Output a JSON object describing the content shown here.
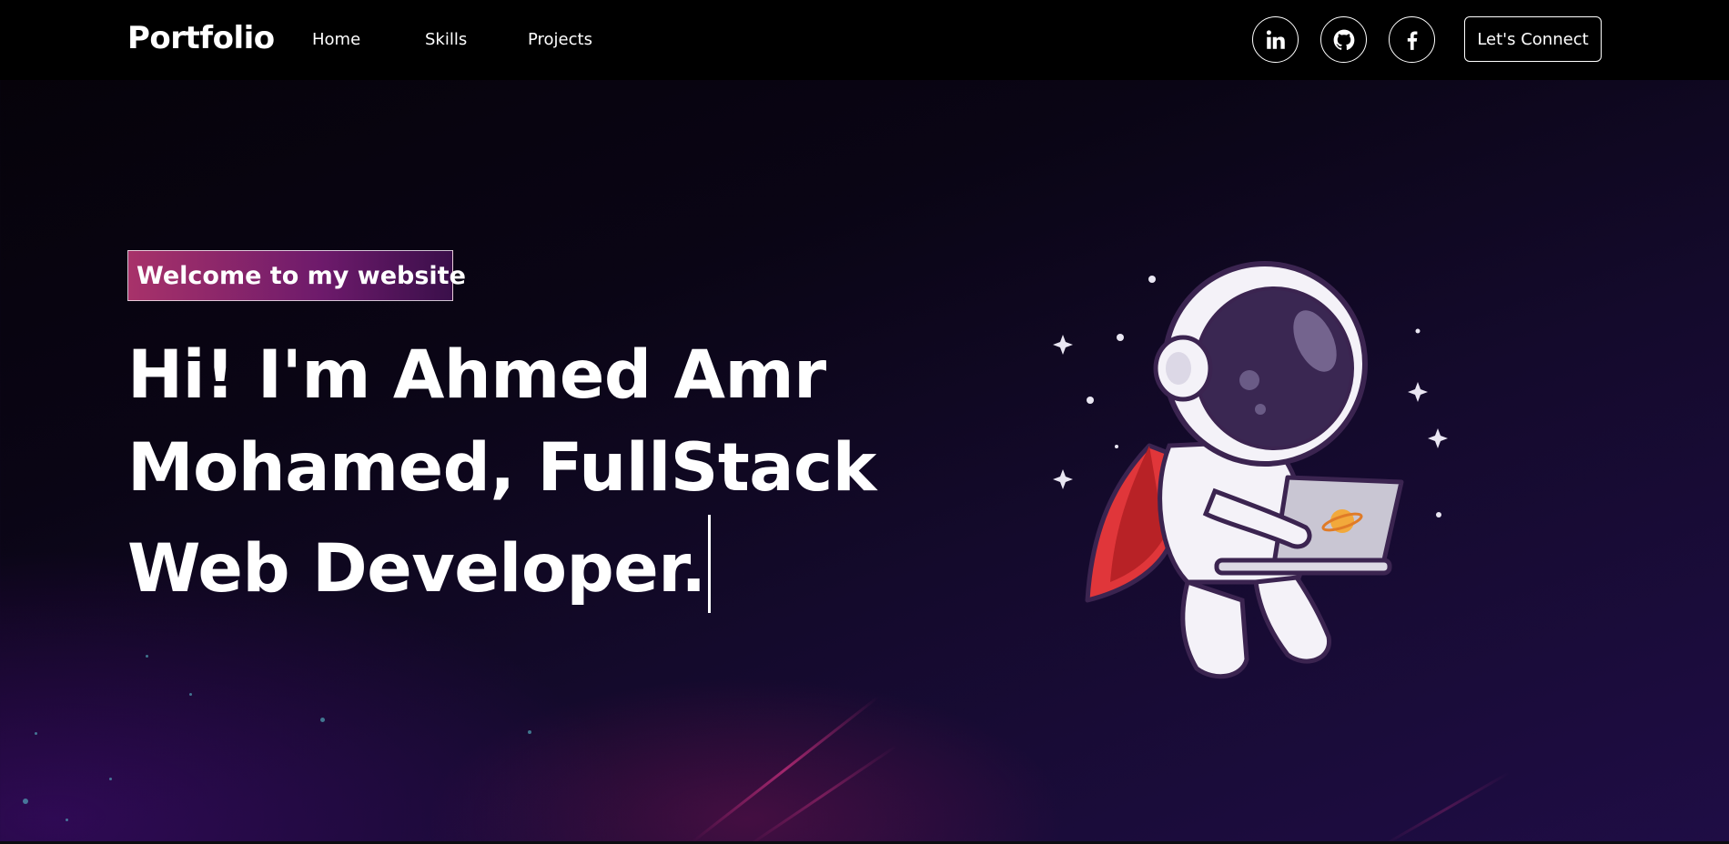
{
  "navbar": {
    "brand": "Portfolio",
    "links": [
      {
        "label": "Home"
      },
      {
        "label": "Skills"
      },
      {
        "label": "Projects"
      }
    ],
    "social": [
      {
        "icon": "linkedin-icon"
      },
      {
        "icon": "github-icon"
      },
      {
        "icon": "facebook-icon"
      }
    ],
    "cta_label": "Let's Connect"
  },
  "hero": {
    "tagline": "Welcome to my website",
    "headline": "Hi! I'm Ahmed Amr Mohamed, FullStack Web Developer.",
    "illustration": "astronaut-with-laptop"
  },
  "colors": {
    "navbar_bg": "#000000",
    "tagline_gradient_start": "#a8326a",
    "tagline_gradient_end": "#3a0f4a",
    "text": "#ffffff"
  }
}
